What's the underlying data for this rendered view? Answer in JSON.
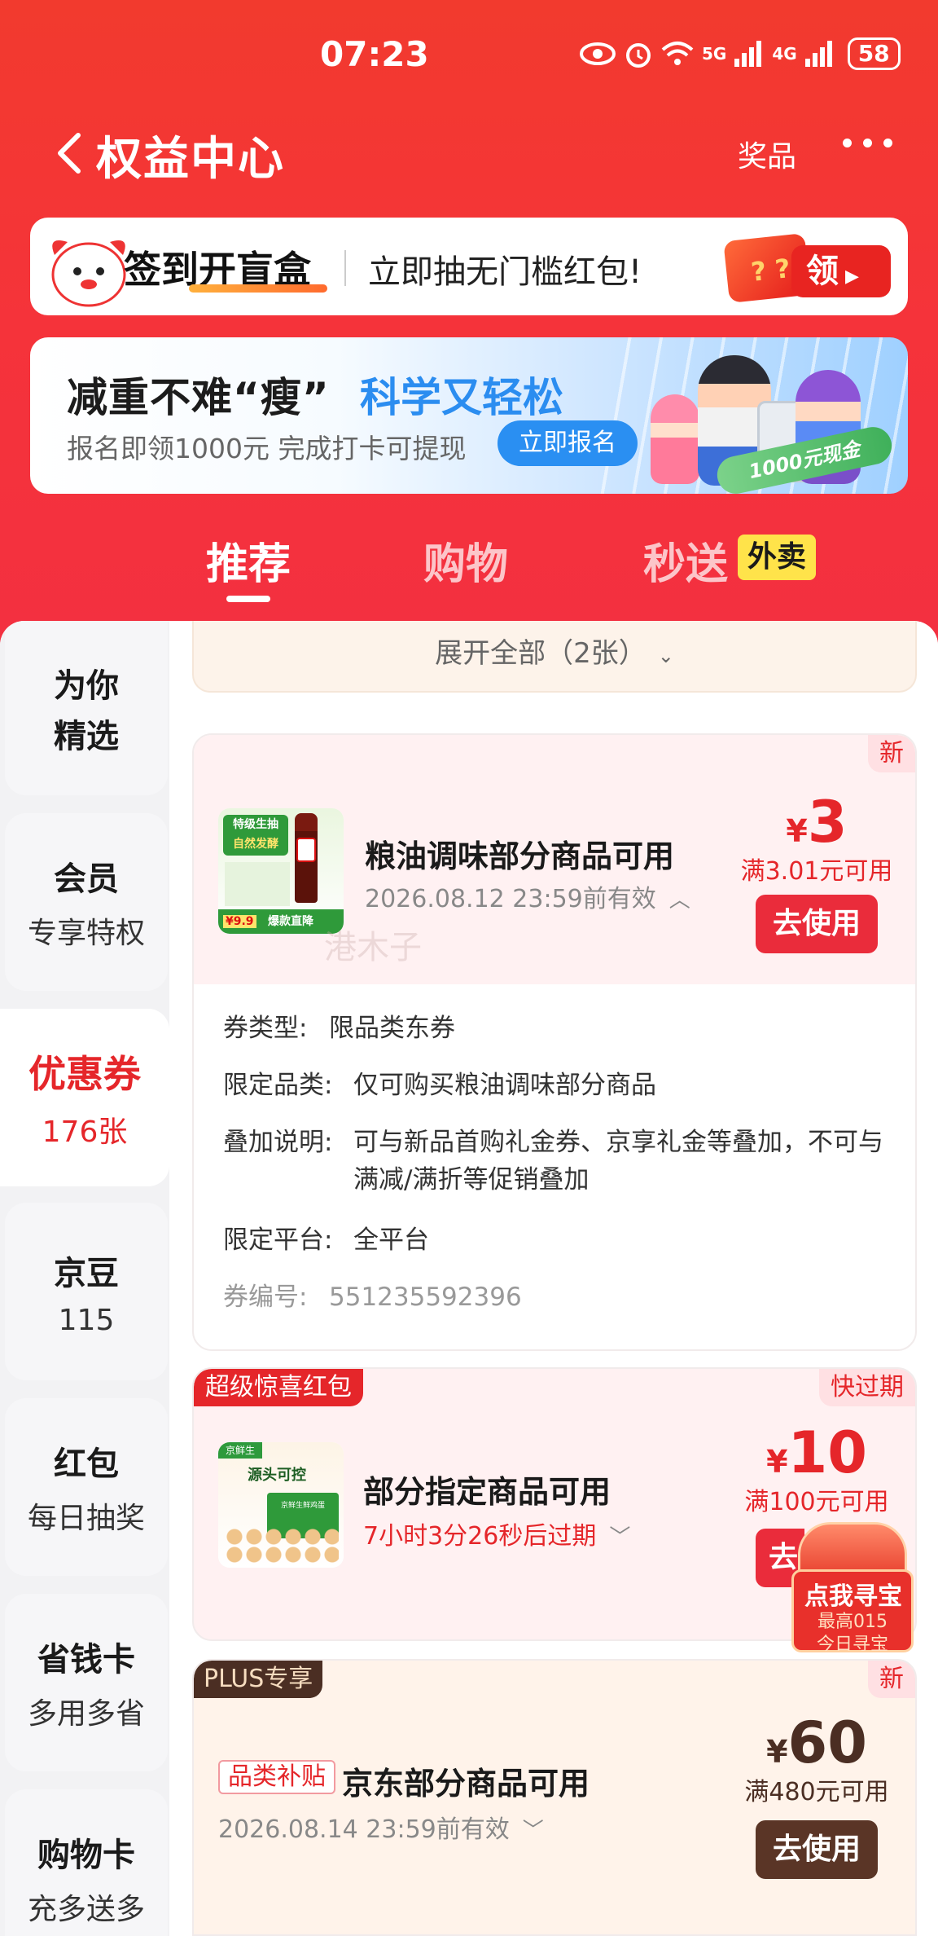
{
  "status": {
    "time": "07:23",
    "network1": "5G",
    "network2": "4G",
    "battery": "58"
  },
  "nav": {
    "title": "权益中心",
    "prize": "奖品"
  },
  "signin": {
    "title": "签到开盲盒",
    "text": "立即抽无门槛红包!",
    "button": "领",
    "box_text": "? ?"
  },
  "banner": {
    "title_a": "减重不难“瘦”",
    "title_b": "科学又轻松",
    "subtitle": "报名即领1000元 完成打卡可提现",
    "button": "立即报名",
    "badge": "1000元现金"
  },
  "tabs": {
    "t1": "推荐",
    "t2": "购物",
    "t3": "秒送",
    "t3_badge": "外卖"
  },
  "sidebar": {
    "items": [
      {
        "a": "为你",
        "b": "精选"
      },
      {
        "a": "会员",
        "b": "专享特权"
      },
      {
        "a": "优惠券",
        "b": "176张"
      },
      {
        "a": "京豆",
        "b": "115"
      },
      {
        "a": "红包",
        "b": "每日抽奖"
      },
      {
        "a": "省钱卡",
        "b": "多用多省"
      },
      {
        "a": "购物卡",
        "b": "充多送多"
      }
    ]
  },
  "expand": {
    "label": "展开全部（2张）"
  },
  "coupons": [
    {
      "tag": "新",
      "thumb_lines": [
        "特级生抽",
        "自然发酵",
        "爆款直降",
        "¥9.9"
      ],
      "title": "粮油调味部分商品可用",
      "date": "2026.08.12 23:59前有效",
      "currency": "¥",
      "amount": "3",
      "condition": "满3.01元可用",
      "button": "去使用",
      "watermark": "港木子",
      "details": [
        {
          "k": "券类型:",
          "v": "限品类东券"
        },
        {
          "k": "限定品类:",
          "v": "仅可购买粮油调味部分商品"
        },
        {
          "k": "叠加说明:",
          "v": "可与新品首购礼金券、京享礼金等叠加，不可与",
          "v2": "满减/满折等促销叠加"
        },
        {
          "k": "限定平台:",
          "v": "全平台"
        },
        {
          "k": "券编号:",
          "v": "551235592396"
        }
      ]
    },
    {
      "tag_left": "超级惊喜红包",
      "tag": "快过期",
      "thumb_lines": [
        "京鲜生",
        "源头可控",
        "京鲜生鲜鸡蛋"
      ],
      "title": "部分指定商品可用",
      "date": "7小时3分26秒后过期",
      "currency": "¥",
      "amount": "10",
      "condition": "满100元可用",
      "button": "去",
      "treasure": "点我寻宝",
      "treasure_sub": "最高015",
      "treasure_sub2": "今日寻宝"
    },
    {
      "tag_left": "PLUS专享",
      "tag": "新",
      "badge": "品类补贴",
      "title": "京东部分商品可用",
      "date": "2026.08.14 23:59前有效",
      "currency": "¥",
      "amount": "60",
      "condition": "满480元可用",
      "button": "去使用"
    }
  ]
}
